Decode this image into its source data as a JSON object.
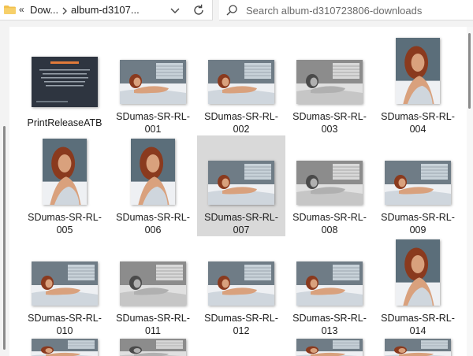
{
  "address_bar": {
    "crumbs": [
      "Dow...",
      "album-d3107..."
    ],
    "back_chevron": "«"
  },
  "search": {
    "placeholder": "Search album-d310723806-downloads"
  },
  "files": [
    {
      "name": "PrintReleaseATB",
      "line1": "PrintReleaseATB",
      "line2": "",
      "kind": "document",
      "icon": "print-release-thumbnail"
    },
    {
      "name": "SDumas-SR-RL-001",
      "line1": "SDumas-SR-RL-",
      "line2": "001",
      "kind": "photo-landscape-color"
    },
    {
      "name": "SDumas-SR-RL-002",
      "line1": "SDumas-SR-RL-",
      "line2": "002",
      "kind": "photo-landscape-color"
    },
    {
      "name": "SDumas-SR-RL-003",
      "line1": "SDumas-SR-RL-",
      "line2": "003",
      "kind": "photo-landscape-bw"
    },
    {
      "name": "SDumas-SR-RL-004",
      "line1": "SDumas-SR-RL-",
      "line2": "004",
      "kind": "photo-portrait-color"
    },
    {
      "name": "SDumas-SR-RL-005",
      "line1": "SDumas-SR-RL-",
      "line2": "005",
      "kind": "photo-portrait-color"
    },
    {
      "name": "SDumas-SR-RL-006",
      "line1": "SDumas-SR-RL-",
      "line2": "006",
      "kind": "photo-portrait-color"
    },
    {
      "name": "SDumas-SR-RL-007",
      "line1": "SDumas-SR-RL-",
      "line2": "007",
      "kind": "photo-landscape-color",
      "selected": true
    },
    {
      "name": "SDumas-SR-RL-008",
      "line1": "SDumas-SR-RL-",
      "line2": "008",
      "kind": "photo-landscape-bw"
    },
    {
      "name": "SDumas-SR-RL-009",
      "line1": "SDumas-SR-RL-",
      "line2": "009",
      "kind": "photo-landscape-color"
    },
    {
      "name": "SDumas-SR-RL-010",
      "line1": "SDumas-SR-RL-",
      "line2": "010",
      "kind": "photo-landscape-color"
    },
    {
      "name": "SDumas-SR-RL-011",
      "line1": "SDumas-SR-RL-",
      "line2": "011",
      "kind": "photo-landscape-bw"
    },
    {
      "name": "SDumas-SR-RL-012",
      "line1": "SDumas-SR-RL-",
      "line2": "012",
      "kind": "photo-landscape-color"
    },
    {
      "name": "SDumas-SR-RL-013",
      "line1": "SDumas-SR-RL-",
      "line2": "013",
      "kind": "photo-landscape-color"
    },
    {
      "name": "SDumas-SR-RL-014",
      "line1": "SDumas-SR-RL-",
      "line2": "014",
      "kind": "photo-portrait-color"
    }
  ],
  "colors": {
    "selection": "#d9d9d9",
    "folder": "#f2c14e",
    "toolbar_bg": "#f3f3f3"
  }
}
